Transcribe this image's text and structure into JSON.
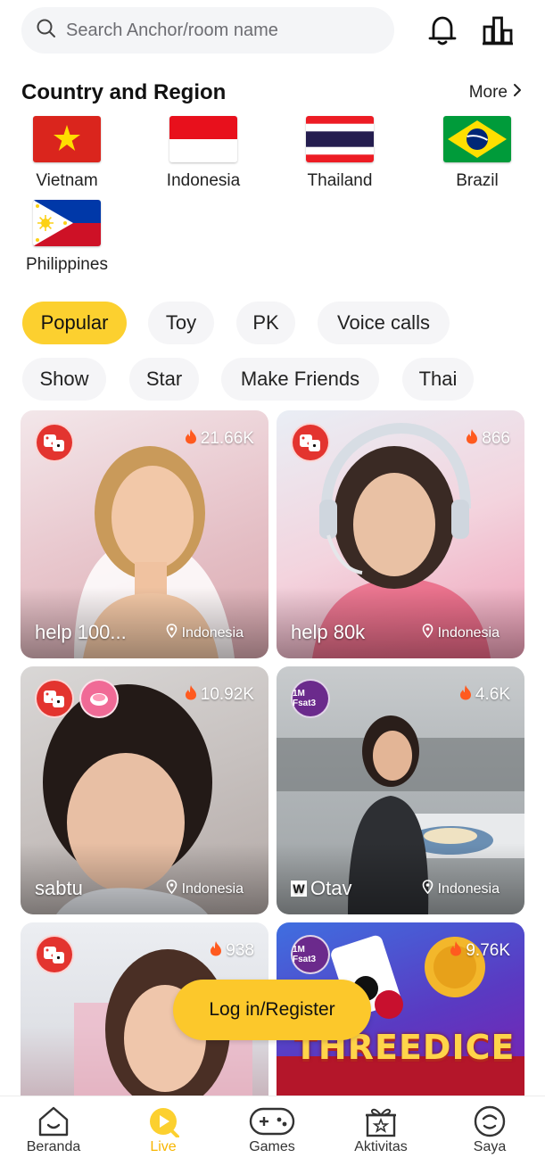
{
  "search": {
    "placeholder": "Search Anchor/room name"
  },
  "header": {
    "notifications_icon": "bell-icon",
    "ranking_icon": "ranking-icon"
  },
  "country_section": {
    "title": "Country and Region",
    "more_label": "More",
    "countries": [
      {
        "name": "Vietnam"
      },
      {
        "name": "Indonesia"
      },
      {
        "name": "Thailand"
      },
      {
        "name": "Brazil"
      },
      {
        "name": "Philippines"
      }
    ]
  },
  "categories": [
    {
      "label": "Popular",
      "active": true
    },
    {
      "label": "Toy"
    },
    {
      "label": "PK"
    },
    {
      "label": "Voice calls"
    },
    {
      "label": "Show"
    },
    {
      "label": "Star"
    },
    {
      "label": "Make Friends"
    },
    {
      "label": "Thai"
    }
  ],
  "streams": [
    {
      "title": "help 100...",
      "viewers": "21.66K",
      "location": "Indonesia",
      "badge": "Sic Bo"
    },
    {
      "title": "help 80k",
      "viewers": "866",
      "location": "Indonesia",
      "badge": "Sic Bo"
    },
    {
      "title": "sabtu",
      "viewers": "10.92K",
      "location": "Indonesia",
      "badge": "Sic Bo"
    },
    {
      "title": "Otav",
      "viewers": "4.6K",
      "location": "Indonesia",
      "badge": "1M Fsat3",
      "tag": "W"
    },
    {
      "title": "",
      "viewers": "938",
      "location": "",
      "badge": "Sic Bo"
    },
    {
      "title": "",
      "viewers": "9.76K",
      "location": "",
      "badge": "1M Fsat3",
      "game_banner": "THREEDICE"
    }
  ],
  "login_button": "Log in/Register",
  "bottom_nav": [
    {
      "label": "Beranda",
      "icon": "home-icon"
    },
    {
      "label": "Live",
      "icon": "live-icon",
      "active": true
    },
    {
      "label": "Games",
      "icon": "gamepad-icon"
    },
    {
      "label": "Aktivitas",
      "icon": "gift-icon"
    },
    {
      "label": "Saya",
      "icon": "profile-icon"
    }
  ],
  "colors": {
    "accent": "#fcd02f",
    "active_nav": "#f7b500"
  }
}
